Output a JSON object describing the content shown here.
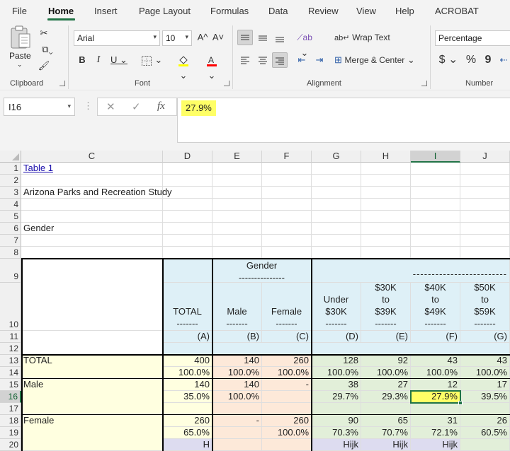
{
  "ribbon": {
    "tabs": [
      "File",
      "Home",
      "Insert",
      "Page Layout",
      "Formulas",
      "Data",
      "Review",
      "View",
      "Help",
      "ACROBAT"
    ],
    "active_tab": "Home",
    "clipboard": {
      "paste_label": "Paste",
      "group_label": "Clipboard"
    },
    "font": {
      "name": "Arial",
      "size": "10",
      "group_label": "Font",
      "bold": "B",
      "italic": "I",
      "underline": "U",
      "grow": "A^",
      "shrink": "A˅",
      "highlight_color": "#ffff00",
      "text_color": "#ff0000"
    },
    "alignment": {
      "wrap_text": "Wrap Text",
      "merge_center": "Merge & Center",
      "group_label": "Alignment"
    },
    "number": {
      "format": "Percentage",
      "currency": "$",
      "percent": "%",
      "comma": "9",
      "group_label": "Number"
    }
  },
  "formula_bar": {
    "name_box": "I16",
    "value": "27.9%",
    "fx": "fx"
  },
  "columns": [
    "C",
    "D",
    "E",
    "F",
    "G",
    "H",
    "I",
    "J"
  ],
  "selected_column": "I",
  "rows": [
    "1",
    "2",
    "3",
    "4",
    "5",
    "6",
    "7",
    "8",
    "9",
    "10",
    "11",
    "12",
    "13",
    "14",
    "15",
    "16",
    "17",
    "18",
    "19",
    "20"
  ],
  "selected_row": "16",
  "sheet": {
    "link_text": "Table 1",
    "title": "Arizona Parks and Recreation Study",
    "variable": "Gender",
    "banner_gender": "Gender\n---------------",
    "banner_income": "-------------------------",
    "headers": {
      "total": "TOTAL\n-------",
      "male": "Male\n-------",
      "female": "Female\n-------",
      "under30": "Under\n$30K\n-------",
      "k30": "$30K\nto\n$39K\n-------",
      "k40": "$40K\nto\n$49K\n-------",
      "k50": "$50K\nto\n$59K\n-------"
    },
    "letters": [
      "(A)",
      "(B)",
      "(C)",
      "(D)",
      "(E)",
      "(F)",
      "(G)"
    ],
    "row_labels": {
      "total": "TOTAL",
      "male": "Male",
      "female": "Female"
    },
    "total_counts": [
      "400",
      "140",
      "260",
      "128",
      "92",
      "43",
      "43"
    ],
    "total_pcts": [
      "100.0%",
      "100.0%",
      "100.0%",
      "100.0%",
      "100.0%",
      "100.0%",
      "100.0%"
    ],
    "male_counts": [
      "140",
      "140",
      "-",
      "38",
      "27",
      "12",
      "17"
    ],
    "male_pcts": [
      "35.0%",
      "100.0%",
      "",
      "29.7%",
      "29.3%",
      "27.9%",
      "39.5%"
    ],
    "female_counts": [
      "260",
      "-",
      "260",
      "90",
      "65",
      "31",
      "26"
    ],
    "female_pcts": [
      "65.0%",
      "",
      "100.0%",
      "70.3%",
      "70.7%",
      "72.1%",
      "60.5%"
    ],
    "sig_letters": [
      "H",
      "",
      "",
      "Hijk",
      "Hijk",
      "Hijk",
      ""
    ]
  }
}
